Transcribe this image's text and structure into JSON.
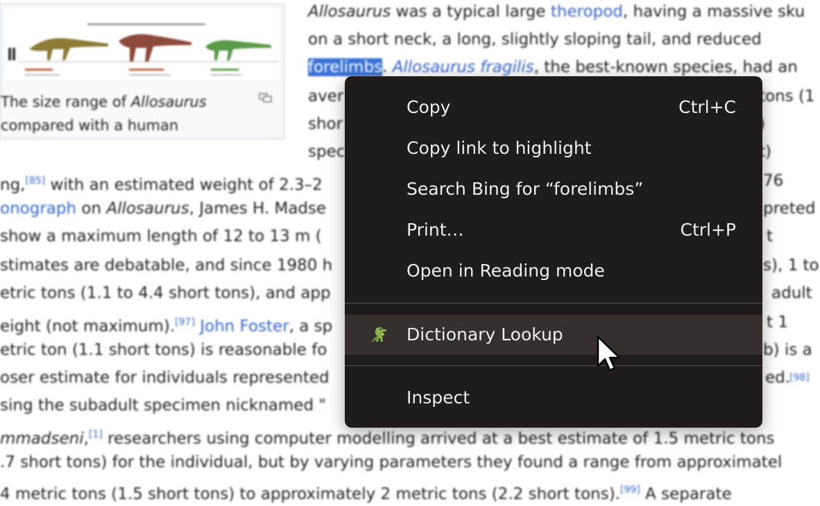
{
  "article": {
    "figure_caption_parts": [
      "The size range of ",
      "Allosaurus",
      " compared with a human"
    ],
    "lines": [
      [
        "",
        "Allosaurus",
        " was a typical large ",
        "theropod",
        ", having a massive sku"
      ],
      [
        "on a short neck, a long, slightly sloping tail, and reduced"
      ],
      [
        "forelimbs",
        ". ",
        "Allosaurus fragilis",
        ", the best-known species, had an"
      ],
      [
        "aver",
        "tons (1"
      ],
      [
        "shor",
        ")"
      ],
      [
        "spec",
        "t)"
      ],
      [
        "ng,",
        "[85]",
        " with an estimated weight of 2.3–2",
        "76"
      ],
      [
        "onograph",
        " on ",
        "Allosaurus",
        ", James H. Madse",
        "preted"
      ],
      [
        " show a maximum length of 12 to 13 m (",
        "t"
      ],
      [
        "stimates are debatable, and since 1980 h",
        "s), 1 to"
      ],
      [
        "etric tons (1.1 to 4.4 short tons), and app",
        "adult"
      ],
      [
        "eight (not maximum).",
        "[97]",
        " ",
        "John Foster",
        ", a sp",
        "t 1"
      ],
      [
        "etric ton (1.1 short tons) is reasonable fo",
        "b) is a"
      ],
      [
        "oser estimate for individuals represented",
        "ed.",
        "[98]"
      ],
      [
        "sing the subadult specimen nicknamed \""
      ],
      [
        "mmadseni",
        ",",
        "[1]",
        " researchers using computer modelling arrived at a best estimate of 1.5 metric tons"
      ],
      [
        ".7 short tons) for the individual, but by varying parameters they found a range from approximatel"
      ],
      [
        "4 metric tons (1.5 short tons) to approximately 2 metric tons (2.2 short tons).",
        "[99]",
        " A separate"
      ]
    ]
  },
  "context_menu": {
    "items": [
      {
        "label": "Copy",
        "shortcut": "Ctrl+C"
      },
      {
        "label": "Copy link to highlight",
        "shortcut": ""
      },
      {
        "label": "Search Bing for “forelimbs”",
        "shortcut": ""
      },
      {
        "label": "Print…",
        "shortcut": "Ctrl+P"
      },
      {
        "label": "Open in Reading mode",
        "shortcut": ""
      },
      {
        "label": "Dictionary Lookup",
        "shortcut": "",
        "icon": "dinosaur-icon",
        "hovered": true
      },
      {
        "label": "Inspect",
        "shortcut": ""
      }
    ]
  },
  "colors": {
    "menu_background": "#1f1c1b",
    "menu_hover": "#35302e",
    "menu_separator": "#6a4a3a",
    "link": "#3366cc",
    "selection": "#3a73d6"
  }
}
